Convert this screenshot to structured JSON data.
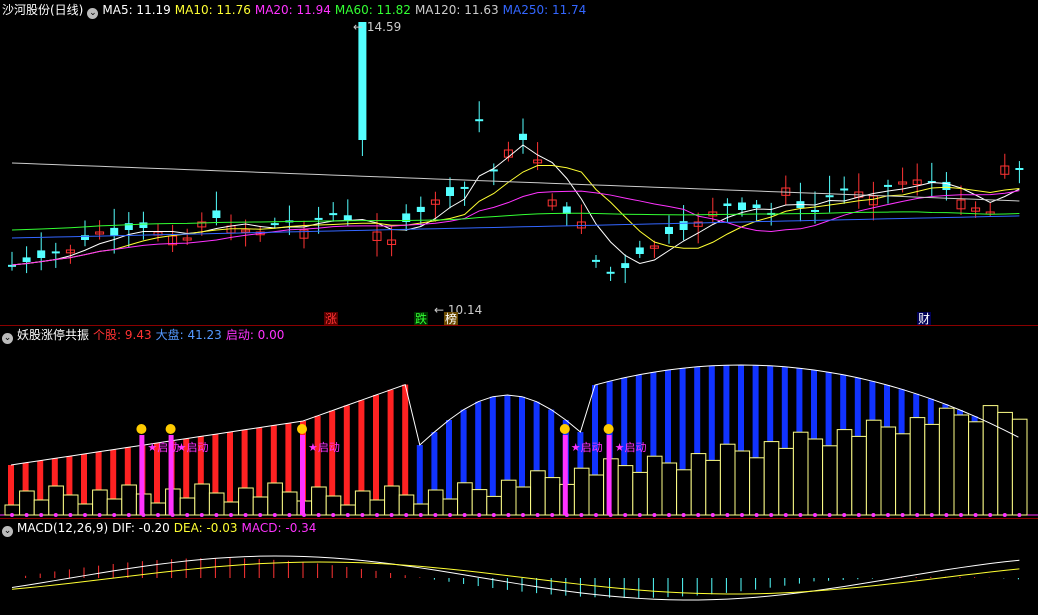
{
  "main": {
    "stock_title": "沙河股份(日线)",
    "ma": [
      {
        "label": "MA5: 11.19",
        "color": "#ffffff"
      },
      {
        "label": "MA10: 11.76",
        "color": "#ffff33"
      },
      {
        "label": "MA20: 11.94",
        "color": "#ff33ff"
      },
      {
        "label": "MA60: 11.82",
        "color": "#33ff33"
      },
      {
        "label": "MA120: 11.63",
        "color": "#cccccc"
      },
      {
        "label": "MA250: 11.74",
        "color": "#3366ff"
      }
    ],
    "high_label": "14.59",
    "low_label": "10.14",
    "tags": [
      {
        "text": "涨",
        "color": "#ff3333",
        "bg": "#5a0000"
      },
      {
        "text": "跌",
        "color": "#33ff33",
        "bg": "#003300"
      },
      {
        "text": "榜",
        "color": "#ffffff",
        "bg": "#6a4a00"
      },
      {
        "text": "财",
        "color": "#ffffff",
        "bg": "#000055"
      }
    ]
  },
  "indicator": {
    "title": "妖股涨停共振",
    "items": [
      {
        "label": "个股: 9.43",
        "color": "#ff3333"
      },
      {
        "label": "大盘: 41.23",
        "color": "#5599ff"
      },
      {
        "label": "启动: 0.00",
        "color": "#ff33ff"
      }
    ],
    "start_label": "启动"
  },
  "macd": {
    "title": "MACD(12,26,9)",
    "items": [
      {
        "label": "DIF: -0.20",
        "color": "#ffffff"
      },
      {
        "label": "DEA: -0.03",
        "color": "#ffff33"
      },
      {
        "label": "MACD: -0.34",
        "color": "#ff33ff"
      }
    ]
  },
  "colors": {
    "up": "#ff3333",
    "down": "#54ffff",
    "grid": "#8a0000",
    "bg": "#000000"
  }
}
